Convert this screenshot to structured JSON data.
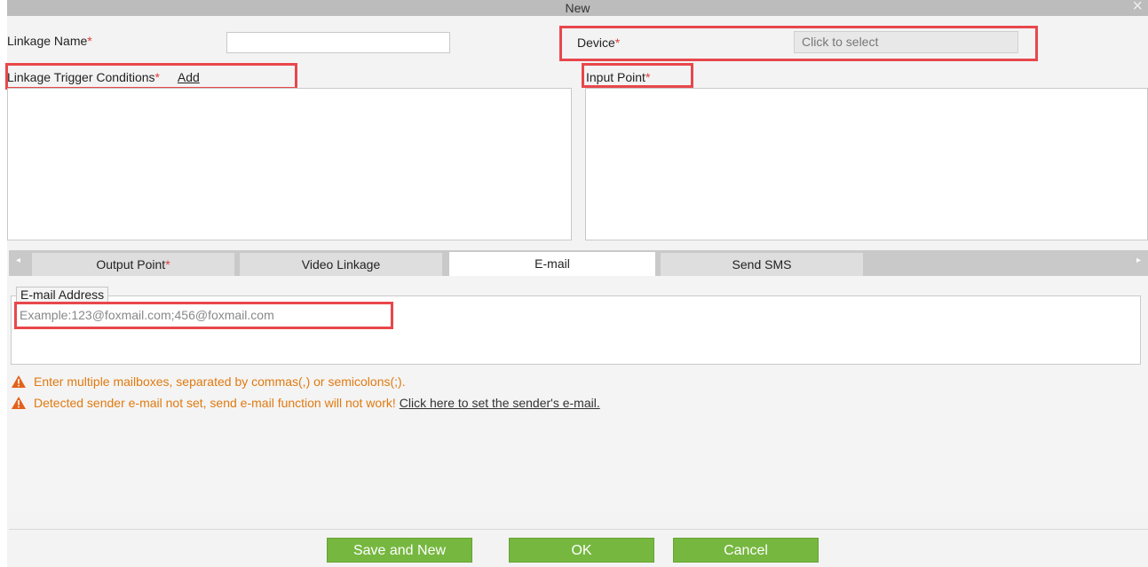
{
  "window": {
    "title": "New",
    "close_label": "×"
  },
  "form": {
    "linkage_name": {
      "label": "Linkage Name",
      "required_mark": "*",
      "value": ""
    },
    "device": {
      "label": "Device",
      "required_mark": "*",
      "placeholder": "Click to select"
    },
    "trigger_conditions": {
      "label": "Linkage Trigger Conditions",
      "required_mark": "*",
      "add_link": "Add"
    },
    "input_point": {
      "label": "Input Point",
      "required_mark": "*"
    }
  },
  "tabs": {
    "items": [
      {
        "label": "Output Point",
        "required_mark": "*"
      },
      {
        "label": "Video Linkage",
        "required_mark": ""
      },
      {
        "label": "E-mail",
        "required_mark": ""
      },
      {
        "label": "Send SMS",
        "required_mark": ""
      }
    ],
    "active_index": 2,
    "left_arrow": "◂",
    "right_arrow": "▸"
  },
  "email_panel": {
    "legend": "E-mail Address",
    "placeholder": "Example:123@foxmail.com;456@foxmail.com",
    "hint_1": "Enter multiple mailboxes, separated by commas(,) or semicolons(;).",
    "hint_2": "Detected sender e-mail not set, send e-mail function will not work!",
    "hint_2_link": "Click here to set the sender's e-mail."
  },
  "buttons": {
    "save_and_new": "Save and New",
    "ok": "OK",
    "cancel": "Cancel"
  },
  "colors": {
    "accent_green": "#76b740",
    "highlight_red": "#e8474c",
    "warning_orange": "#e07a10",
    "required_red": "#e23b3b"
  }
}
